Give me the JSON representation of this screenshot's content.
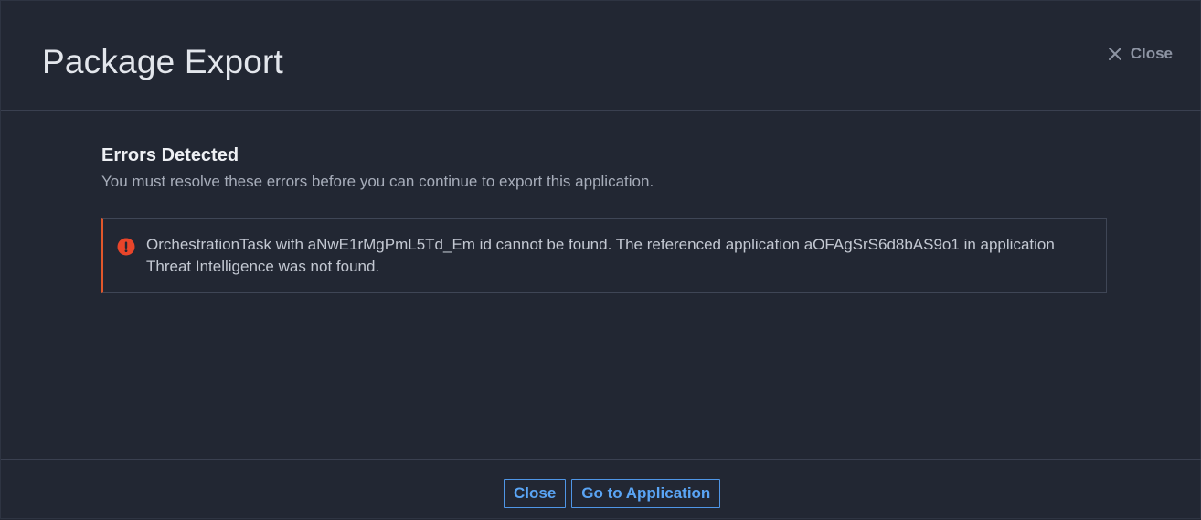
{
  "modal": {
    "title": "Package Export",
    "close_label": "Close"
  },
  "errors": {
    "heading": "Errors Detected",
    "subtitle": "You must resolve these errors before you can continue to export this application.",
    "items": [
      {
        "message": "OrchestrationTask with aNwE1rMgPmL5Td_Em id cannot be found. The referenced application aOFAgSrS6d8bAS9o1 in application Threat Intelligence was not found.",
        "icon": "exclamation-circle-icon"
      }
    ]
  },
  "footer": {
    "close_button": "Close",
    "go_button": "Go to Application"
  },
  "colors": {
    "background": "#222733",
    "accent": "#5aa5f5",
    "error": "#e2572b"
  }
}
